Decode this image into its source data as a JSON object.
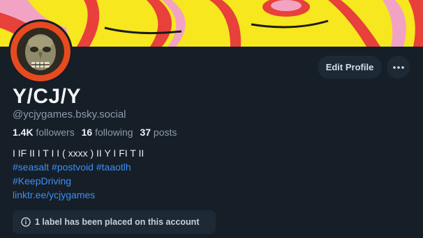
{
  "profile": {
    "display_name": "Y/CJ/Y",
    "handle": "@ycjygames.bsky.social"
  },
  "stats": {
    "followers_count": "1.4K",
    "followers_label": "followers",
    "following_count": "16",
    "following_label": "following",
    "posts_count": "37",
    "posts_label": "posts"
  },
  "bio": {
    "line1": "I IF II I T I I ( xxxx )  II Y I FI T II",
    "hashtags1": "#seasalt #postvoid #taaotlh",
    "hashtags2": "#KeepDriving",
    "link": "linktr.ee/ycjygames"
  },
  "actions": {
    "edit_profile_label": "Edit Profile",
    "more_icon": "more-horizontal-icon"
  },
  "labels_notice": {
    "text": "1 label has been placed on this account",
    "icon": "info-icon"
  },
  "colors": {
    "background": "#161e27",
    "button_bg": "#1e2936",
    "link": "#3b90f5",
    "muted_text": "#8e9bab",
    "banner_yellow": "#f6e71f",
    "banner_red": "#e8403a",
    "banner_pink": "#f2a3c4"
  }
}
